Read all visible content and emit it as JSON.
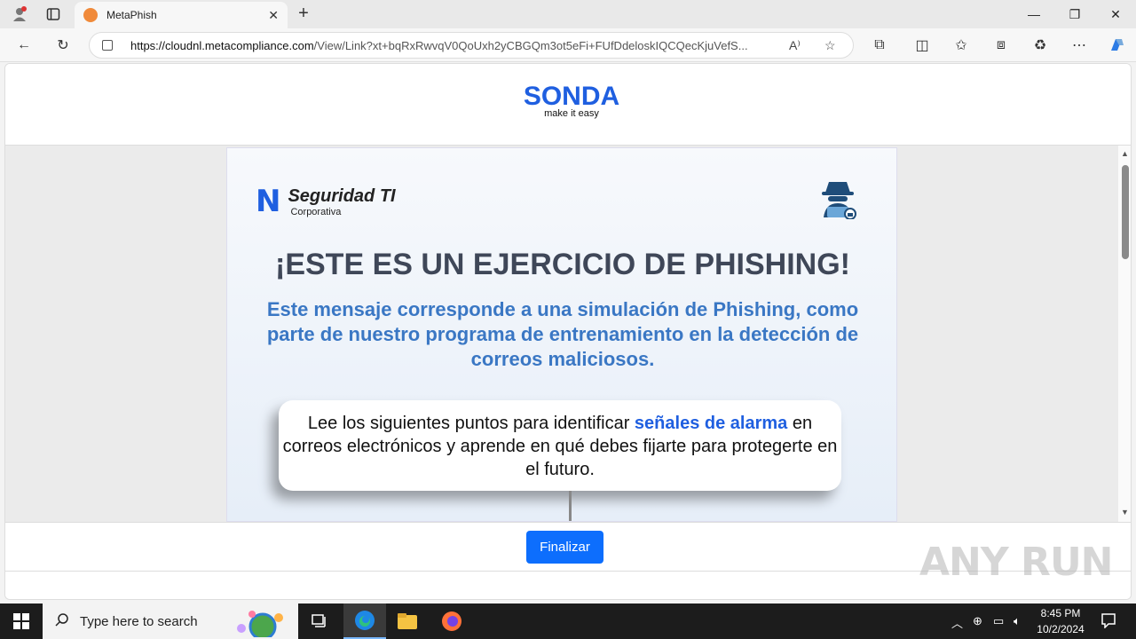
{
  "browser": {
    "tab_title": "MetaPhish",
    "url_host": "https://cloudnl.metacompliance.com",
    "url_path": "/View/Link?xt+bqRxRwvqV0QoUxh2yCBGQm3ot5eFi+FUfDdeloskIQCQecKjuVefS..."
  },
  "page": {
    "sonda_logo": "SONDA",
    "sonda_tagline": "make it easy",
    "brand_title": "Seguridad TI",
    "brand_subtitle": "Corporativa",
    "headline": "¡ESTE ES UN EJERCICIO DE PHISHING!",
    "subheadline": "Este mensaje corresponde a una simulación de Phishing, como parte de nuestro programa de entrenamiento en la detección de correos maliciosos.",
    "box_text_before": "Lee los siguientes puntos para identificar ",
    "box_highlight": "señales de alarma",
    "box_text_after": " en correos electrónicos y aprende en qué debes fijarte para protegerte en el futuro.",
    "finish_button": "Finalizar"
  },
  "watermark": "ANY RUN",
  "taskbar": {
    "search_placeholder": "Type here to search",
    "time": "8:45 PM",
    "date": "10/2/2024"
  },
  "colors": {
    "accent": "#1f5fe0",
    "button": "#0d6efd",
    "subheadline": "#3a77c4"
  }
}
